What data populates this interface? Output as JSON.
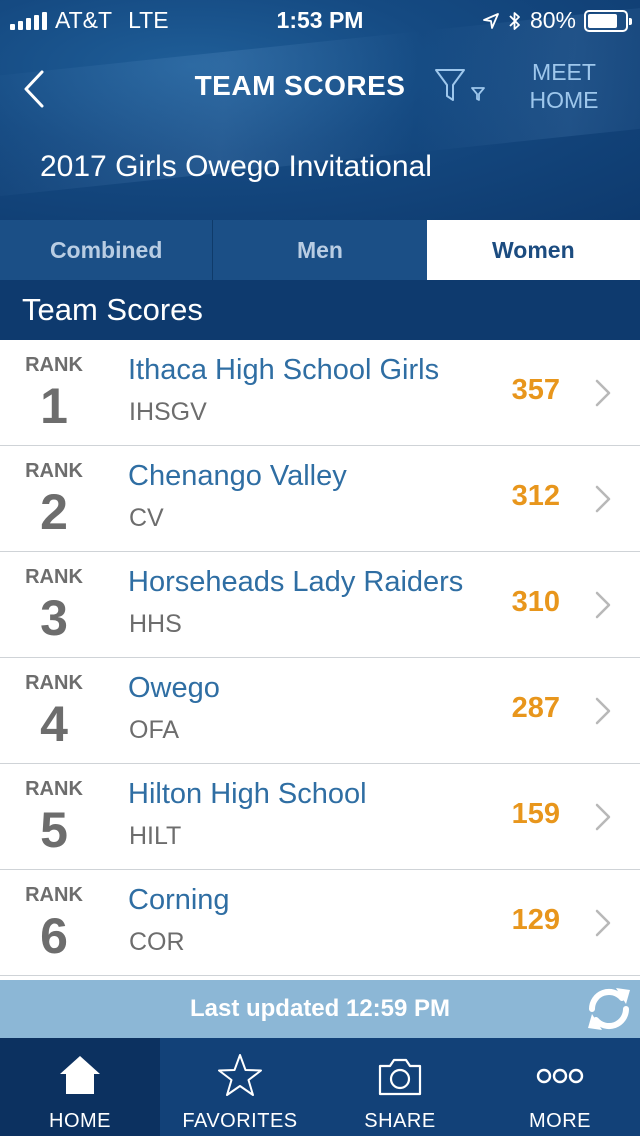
{
  "status_bar": {
    "carrier": "AT&T",
    "network": "LTE",
    "time": "1:53 PM",
    "battery": "80%",
    "battery_level": 0.8
  },
  "nav": {
    "title": "TEAM SCORES",
    "meet_home_label": "MEET HOME"
  },
  "meet_name": "2017 Girls Owego Invitational",
  "tabs": [
    {
      "label": "Combined",
      "active": false
    },
    {
      "label": "Men",
      "active": false
    },
    {
      "label": "Women",
      "active": true
    }
  ],
  "section_title": "Team Scores",
  "rank_label": "RANK",
  "teams": [
    {
      "rank": "1",
      "name": "Ithaca High School Girls",
      "abbr": "IHSGV",
      "score": "357"
    },
    {
      "rank": "2",
      "name": "Chenango Valley",
      "abbr": "CV",
      "score": "312"
    },
    {
      "rank": "3",
      "name": "Horseheads Lady Raiders",
      "abbr": "HHS",
      "score": "310"
    },
    {
      "rank": "4",
      "name": "Owego",
      "abbr": "OFA",
      "score": "287"
    },
    {
      "rank": "5",
      "name": "Hilton High School",
      "abbr": "HILT",
      "score": "159"
    },
    {
      "rank": "6",
      "name": "Corning",
      "abbr": "COR",
      "score": "129"
    }
  ],
  "last_updated": "Last updated 12:59 PM",
  "tabbar": [
    {
      "label": "HOME",
      "icon": "home-icon",
      "active": true
    },
    {
      "label": "FAVORITES",
      "icon": "star-icon",
      "active": false
    },
    {
      "label": "SHARE",
      "icon": "camera-icon",
      "active": false
    },
    {
      "label": "MORE",
      "icon": "more-dots-icon",
      "active": false
    }
  ],
  "colors": {
    "header_bg": "#154a82",
    "tab_bg": "#1b4f86",
    "section_bg": "#0e3a6e",
    "team_name": "#2f6ea3",
    "score": "#e8961c",
    "updated_bar": "#8cb7d6",
    "tabbar_bg": "#124178"
  }
}
